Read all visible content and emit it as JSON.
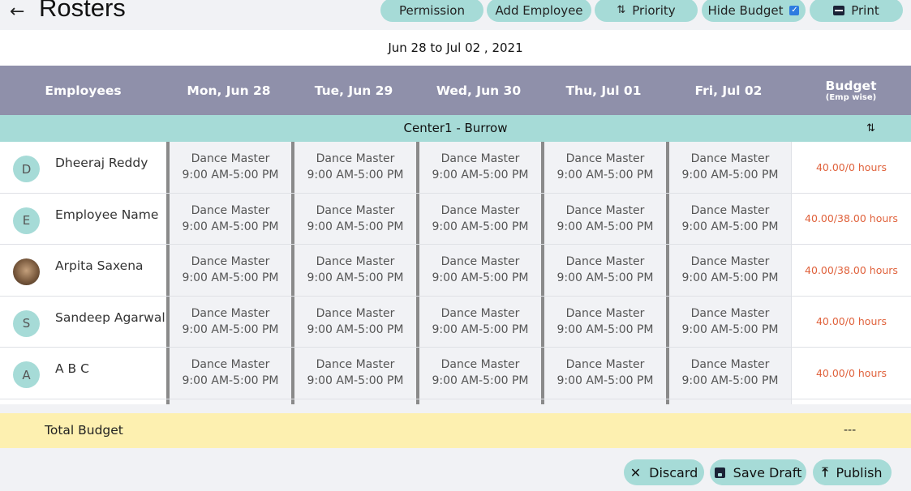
{
  "header": {
    "back_icon": "arrow-left-icon",
    "title": "Rosters",
    "buttons": {
      "permission": "Permission",
      "add_employee": "Add Employee",
      "priority": "Priority",
      "hide_budget": "Hide Budget",
      "hide_budget_checked": true,
      "print": "Print"
    }
  },
  "date_range": "Jun 28 to Jul 02 , 2021",
  "columns": {
    "employees": "Employees",
    "days": [
      "Mon, Jun 28",
      "Tue, Jun 29",
      "Wed, Jun 30",
      "Thu, Jul 01",
      "Fri, Jul 02"
    ],
    "budget": "Budget",
    "budget_sub": "(Emp wise)"
  },
  "center_name": "Center1 - Burrow",
  "shift_role": "Dance Master",
  "shift_time": "9:00 AM-5:00 PM",
  "employees": [
    {
      "initial": "D",
      "name": "Dheeraj Reddy",
      "budget": "40.00/0 hours",
      "photo": false
    },
    {
      "initial": "E",
      "name": "Employee Name",
      "budget": "40.00/38.00 hours",
      "photo": false
    },
    {
      "initial": "",
      "name": "Arpita Saxena",
      "budget": "40.00/38.00 hours",
      "photo": true
    },
    {
      "initial": "S",
      "name": "Sandeep Agarwal",
      "budget": "40.00/0 hours",
      "photo": false
    },
    {
      "initial": "A",
      "name": "A B C",
      "budget": "40.00/0 hours",
      "photo": false
    }
  ],
  "total": {
    "label": "Total Budget",
    "value": "---"
  },
  "actions": {
    "discard": "Discard",
    "save_draft": "Save Draft",
    "publish": "Publish"
  },
  "colors": {
    "accent": "#a6dbd7",
    "header": "#8f90aa",
    "budget_text": "#e0623c",
    "total_bg": "#fdf0b0"
  }
}
